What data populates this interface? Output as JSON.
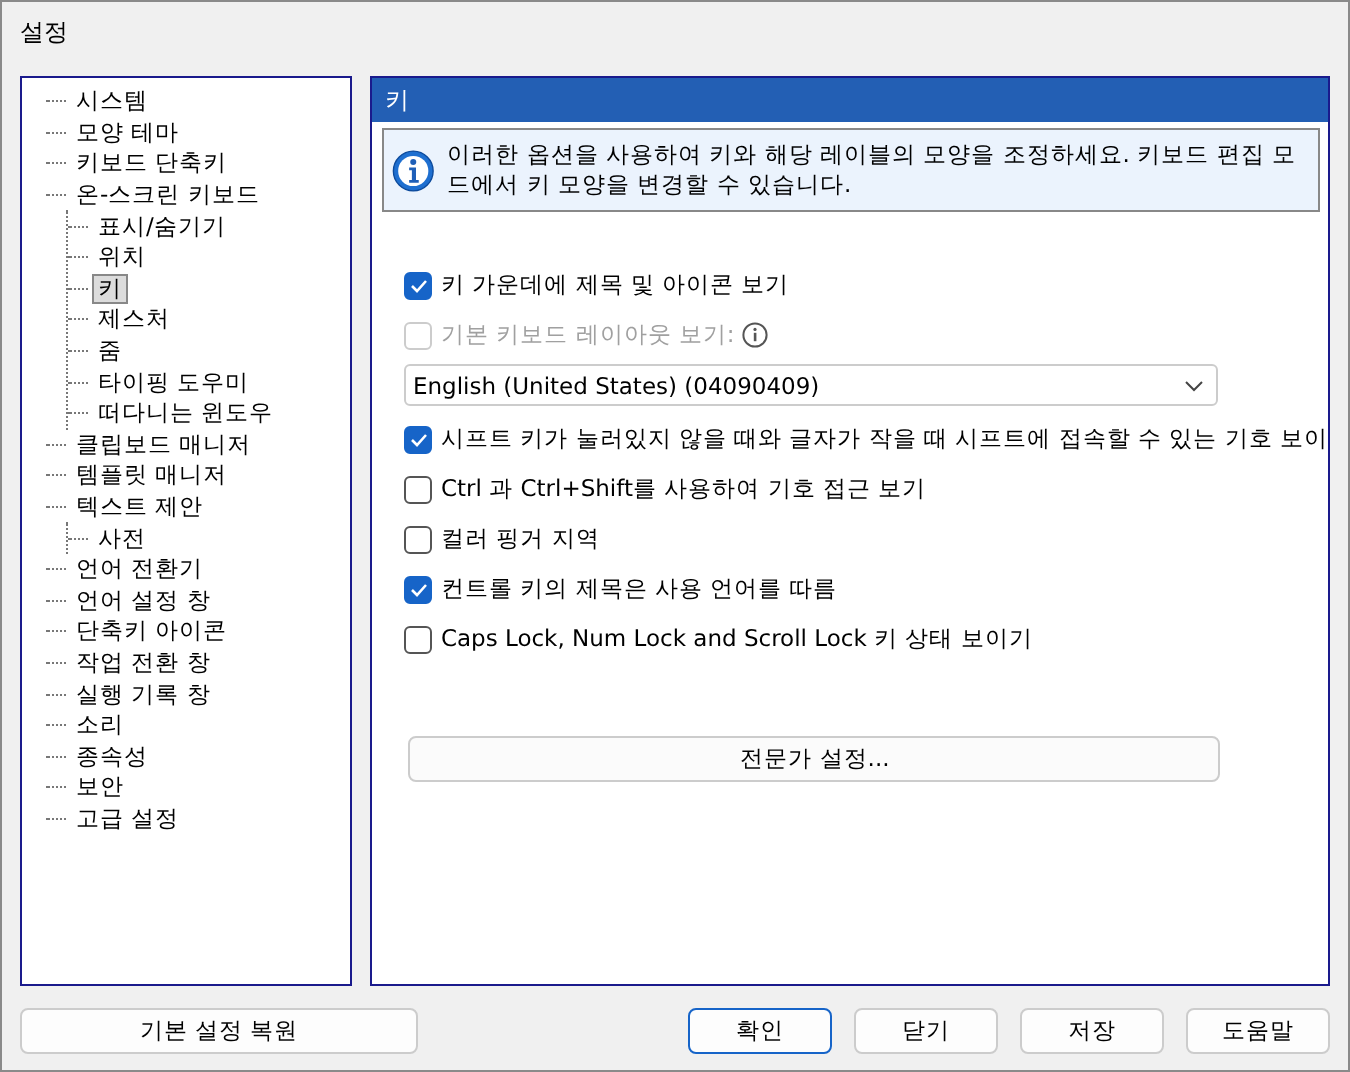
{
  "window": {
    "title": "설정"
  },
  "sidebar": {
    "items": [
      {
        "label": "시스템",
        "selected": false
      },
      {
        "label": "모양 테마",
        "selected": false
      },
      {
        "label": "키보드 단축키",
        "selected": false
      },
      {
        "label": "온-스크린 키보드",
        "selected": false,
        "children": [
          {
            "label": "표시/숨기기",
            "selected": false
          },
          {
            "label": "위치",
            "selected": false
          },
          {
            "label": "키",
            "selected": true
          },
          {
            "label": "제스처",
            "selected": false
          },
          {
            "label": "줌",
            "selected": false
          },
          {
            "label": "타이핑 도우미",
            "selected": false
          },
          {
            "label": "떠다니는 윈도우",
            "selected": false
          }
        ]
      },
      {
        "label": "클립보드 매니저",
        "selected": false
      },
      {
        "label": "템플릿 매니저",
        "selected": false
      },
      {
        "label": "텍스트 제안",
        "selected": false,
        "children": [
          {
            "label": "사전",
            "selected": false
          }
        ]
      },
      {
        "label": "언어 전환기",
        "selected": false
      },
      {
        "label": "언어 설정 창",
        "selected": false
      },
      {
        "label": "단축키 아이콘",
        "selected": false
      },
      {
        "label": "작업 전환 창",
        "selected": false
      },
      {
        "label": "실행 기록 창",
        "selected": false
      },
      {
        "label": "소리",
        "selected": false
      },
      {
        "label": "종속성",
        "selected": false
      },
      {
        "label": "보안",
        "selected": false
      },
      {
        "label": "고급 설정",
        "selected": false
      }
    ]
  },
  "panel": {
    "title": "키",
    "info": "이러한 옵션을 사용하여 키와 해당 레이블의 모양을 조정하세요. 키보드 편집 모드에서 키 모양을 변경할 수 있습니다.",
    "options": [
      {
        "kind": "checkbox",
        "label": "키 가운데에 제목 및 아이콘 보기",
        "checked": true,
        "disabled": false
      },
      {
        "kind": "checkbox",
        "label": "기본 키보드 레이아웃 보기:",
        "checked": false,
        "disabled": true,
        "info_icon": true
      },
      {
        "kind": "dropdown",
        "value": "English (United States) (04090409)"
      },
      {
        "kind": "checkbox",
        "label": "시프트 키가 눌러있지 않을 때와 글자가 작을 때 시프트에 접속할 수 있는 기호 보이",
        "checked": true,
        "disabled": false
      },
      {
        "kind": "checkbox",
        "label": "Ctrl 과 Ctrl+Shift를 사용하여 기호 접근 보기",
        "checked": false,
        "disabled": false
      },
      {
        "kind": "checkbox",
        "label": "컬러 핑거 지역",
        "checked": false,
        "disabled": false
      },
      {
        "kind": "checkbox",
        "label": "컨트롤 키의 제목은 사용 언어를 따름",
        "checked": true,
        "disabled": false
      },
      {
        "kind": "checkbox",
        "label": "Caps Lock, Num Lock and Scroll Lock 키 상태 보이기",
        "checked": false,
        "disabled": false
      }
    ],
    "expert_button": "전문가 설정..."
  },
  "buttons": {
    "reset": "기본 설정 복원",
    "actions": [
      {
        "label": "확인",
        "selected": true
      },
      {
        "label": "닫기",
        "selected": false
      },
      {
        "label": "저장",
        "selected": false
      },
      {
        "label": "도움말",
        "selected": false
      }
    ]
  }
}
